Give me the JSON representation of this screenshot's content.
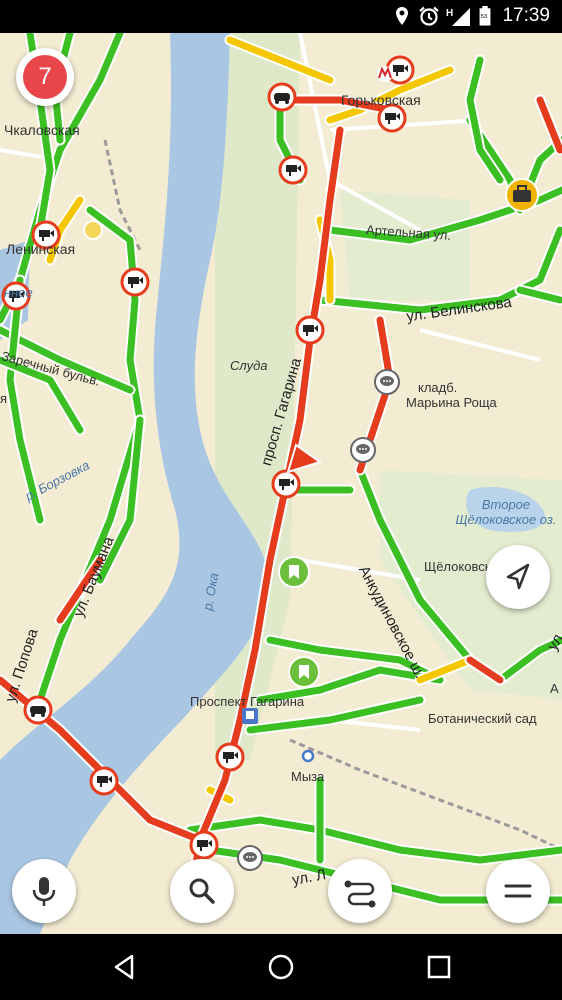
{
  "status_bar": {
    "time": "17:39",
    "icons": [
      "location-icon",
      "alarm-icon",
      "network-h-icon",
      "battery-icon"
    ]
  },
  "traffic": {
    "level": "7",
    "colors": {
      "free": "#3bbf22",
      "medium": "#f5c700",
      "heavy": "#e63c1e"
    }
  },
  "map": {
    "labels": {
      "chkalovskaya": "Чкаловская",
      "gorkovskaya": "Горьковская",
      "leninskaya": "Ленинская",
      "nnoe": "нное",
      "artelnaya": "Артельная ул.",
      "belinskogo": "ул. Белинскова",
      "zarechny": "Заречный бульв.",
      "ya": "я",
      "sluda": "Слуда",
      "kladb": "кладб.",
      "marina_roscha": "Марьина Роща",
      "borzovka": "р. Борзовка",
      "prospekt_gagarina_road": "просп. Гагарина",
      "vtoroe_ozero": "Второе Щёлоковское оз.",
      "shchelokovsky": "Щёлоковский хутор",
      "baumana": "ул. Баумана",
      "anyudinovskoe": "Анкудиновское ш.",
      "oka": "р. Ока",
      "popova": "ул. Попова",
      "prospekt_gagarina_stop": "Проспект Гагарина",
      "botanic": "Ботанический сад",
      "myza": "Мыза",
      "ul_l": "ул. Л",
      "ul_right": "ул",
      "a_right": "А"
    }
  },
  "controls": {
    "mic": "microphone-icon",
    "search": "search-icon",
    "route": "route-icon",
    "menu": "menu-icon",
    "locate": "navigation-arrow-icon"
  },
  "nav": {
    "back": "back-icon",
    "home": "home-icon",
    "recents": "recents-icon"
  }
}
